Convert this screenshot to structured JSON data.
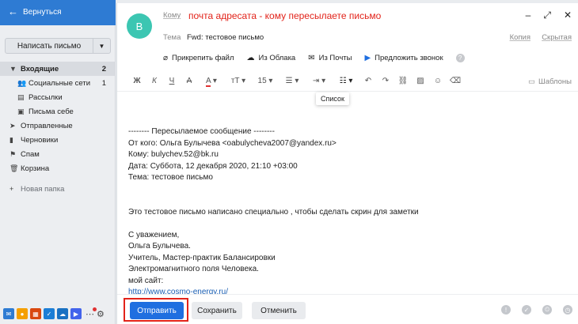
{
  "topbar": {
    "back_label": "Вернуться"
  },
  "sidebar": {
    "compose_label": "Написать письмо",
    "folders": [
      {
        "label": "Входящие",
        "count": "2",
        "icon": "inbox-icon"
      },
      {
        "label": "Социальные сети",
        "count": "1",
        "icon": "people-icon"
      },
      {
        "label": "Рассылки",
        "count": "",
        "icon": "newsletter-icon"
      },
      {
        "label": "Письма себе",
        "count": "",
        "icon": "self-mail-icon"
      },
      {
        "label": "Отправленные",
        "count": "",
        "icon": "sent-icon"
      },
      {
        "label": "Черновики",
        "count": "",
        "icon": "drafts-icon"
      },
      {
        "label": "Спам",
        "count": "",
        "icon": "spam-icon"
      },
      {
        "label": "Корзина",
        "count": "",
        "icon": "trash-icon"
      }
    ],
    "new_folder_label": "Новая папка"
  },
  "compose": {
    "avatar_letter": "B",
    "to_label": "Кому",
    "annotation": "почта адресата - кому пересылаете письмо",
    "subject_label": "Тема",
    "subject_value": "Fwd: тестовое письмо",
    "copy_label": "Копия",
    "bcc_label": "Скрытая",
    "attach": {
      "file_label": "Прикрепить файл",
      "cloud_label": "Из Облака",
      "mail_label": "Из Почты",
      "call_label": "Предложить звонок"
    },
    "format": {
      "bold": "Ж",
      "italic": "К",
      "underline": "Ч",
      "strike": "A",
      "color": "A",
      "size_label": "15",
      "list_tooltip": "Список"
    },
    "templates_label": "Шаблоны",
    "body": {
      "l1": "-------- Пересылаемое сообщение --------",
      "l2": "От кого: Ольга Булычева <oabulycheva2007@yandex.ru>",
      "l3": "Кому: bulychev.52@bk.ru",
      "l4": "Дата: Суббота, 12 декабря 2020, 21:10 +03:00",
      "l5": "Тема: тестовое письмо",
      "l6": "Это тестовое письмо написано специально , чтобы сделать скрин для заметки",
      "l7": "С уважением,",
      "l8": "Ольга Булычева.",
      "l9": "Учитель, Мастер-практик Балансировки",
      "l10": "Электромагнитного поля Человека.",
      "l11": "мой сайт:",
      "l12": "http://www.cosmo-energy.ru/"
    },
    "send_label": "Отправить",
    "save_label": "Сохранить",
    "cancel_label": "Отменить"
  },
  "colors": {
    "accent": "#1f6fe0",
    "topbar": "#2e7bd3",
    "annotation": "#e2231a",
    "avatar": "#3cc6b2"
  }
}
